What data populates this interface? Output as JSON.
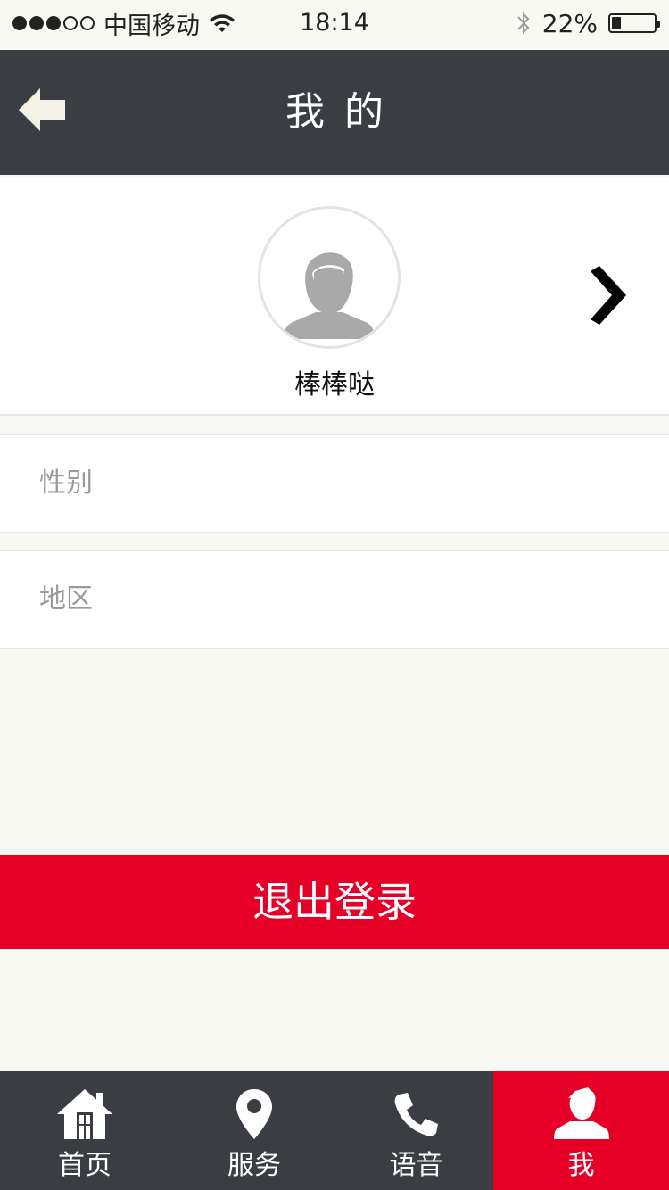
{
  "status_bar": {
    "carrier": "中国移动",
    "time": "18:14",
    "battery_percent_label": "22%",
    "battery_level": 0.22
  },
  "header": {
    "title": "我的",
    "back_icon": "back-arrow-icon"
  },
  "profile": {
    "username": "棒棒哒",
    "avatar_icon": "default-avatar-icon",
    "chevron_icon": "chevron-right-icon"
  },
  "fields": [
    {
      "label": "性别"
    },
    {
      "label": "地区"
    }
  ],
  "logout": {
    "label": "退出登录"
  },
  "tabs": [
    {
      "label": "首页",
      "icon": "home-icon",
      "active": false
    },
    {
      "label": "服务",
      "icon": "location-pin-icon",
      "active": false
    },
    {
      "label": "语音",
      "icon": "phone-icon",
      "active": false
    },
    {
      "label": "我",
      "icon": "user-icon",
      "active": true
    }
  ],
  "colors": {
    "header_bg": "#3a3d42",
    "accent_red": "#e60028",
    "page_bg": "#f9f9f4"
  }
}
